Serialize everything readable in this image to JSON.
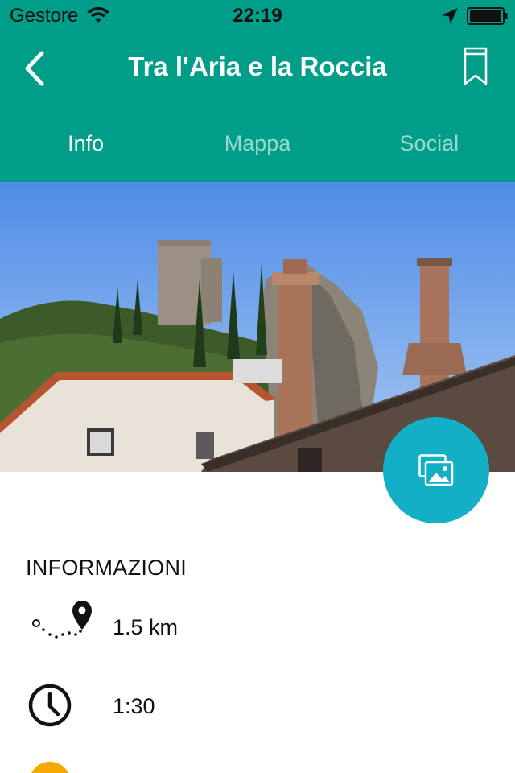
{
  "status_bar": {
    "carrier": "Gestore",
    "time": "22:19",
    "icons": [
      "wifi-icon",
      "location-arrow-icon",
      "battery-icon"
    ]
  },
  "nav": {
    "title": "Tra l'Aria e la Roccia",
    "back_icon": "chevron-left-icon",
    "bookmark_icon": "bookmark-icon"
  },
  "tabs": [
    {
      "label": "Info",
      "active": true
    },
    {
      "label": "Mappa",
      "active": false
    },
    {
      "label": "Social",
      "active": false
    }
  ],
  "gallery_button_icon": "photo-gallery-icon",
  "info": {
    "heading": "INFORMAZIONI",
    "rows": [
      {
        "icon": "route-distance-icon",
        "value": "1.5 km"
      },
      {
        "icon": "clock-icon",
        "value": "1:30"
      }
    ]
  },
  "colors": {
    "header": "#009e88",
    "fab": "#12afc6",
    "partial_icon": "#f6a800"
  }
}
